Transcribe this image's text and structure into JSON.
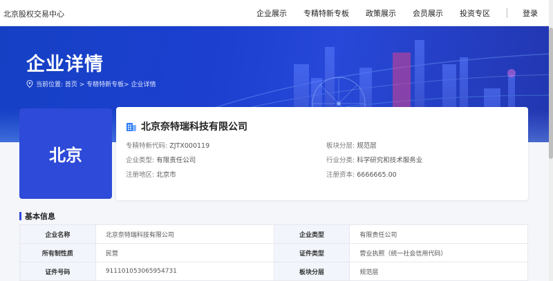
{
  "header": {
    "brand": "北京股权交易中心",
    "nav": [
      "企业展示",
      "专精特新专板",
      "政策展示",
      "会员展示",
      "投资专区"
    ],
    "login": "登录"
  },
  "banner": {
    "title": "企业详情",
    "breadcrumb": "当前位置: 首页 > 专精特新专板> 企业详情"
  },
  "company": {
    "logo_text": "北京",
    "name": "北京奈特瑞科技有限公司",
    "fields": {
      "code_label": "专精特新代码:",
      "code_value": "ZJTX000119",
      "board_label": "板块分层:",
      "board_value": "规范层",
      "type_label": "企业类型:",
      "type_value": "有限责任公司",
      "industry_label": "行业分类:",
      "industry_value": "科学研究和技术服务业",
      "region_label": "注册地区:",
      "region_value": "北京市",
      "capital_label": "注册资本:",
      "capital_value": "6666665.00"
    }
  },
  "basic_info": {
    "title": "基本信息",
    "rows": [
      [
        {
          "label": "企业名称",
          "value": "北京奈特瑞科技有限公司"
        },
        {
          "label": "企业类型",
          "value": "有限责任公司"
        }
      ],
      [
        {
          "label": "所有制性质",
          "value": "民营"
        },
        {
          "label": "证件类型",
          "value": "营业执照（统一社会信用代码）"
        }
      ],
      [
        {
          "label": "证件号码",
          "value": "911101053065954731"
        },
        {
          "label": "板块分层",
          "value": "规范层"
        }
      ]
    ]
  },
  "colors": {
    "accent": "#2e4ad8",
    "banner": "#1c3fd0"
  }
}
